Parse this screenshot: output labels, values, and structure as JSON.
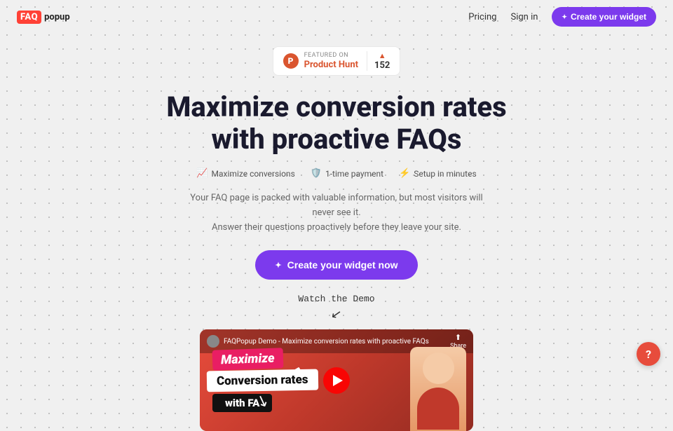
{
  "brand": {
    "logo_faq": "FAQ",
    "logo_popup": "popup"
  },
  "nav": {
    "pricing_label": "Pricing",
    "signin_label": "Sign in",
    "cta_label": "Create your widget"
  },
  "product_hunt": {
    "featured_label": "FEATURED ON",
    "name": "Product Hunt",
    "score": "152",
    "arrow": "▲"
  },
  "hero": {
    "headline_line1": "Maximize conversion rates",
    "headline_line2": "with proactive FAQs",
    "pill1_icon": "📈",
    "pill1_label": "Maximize conversions",
    "pill2_icon": "🛡️",
    "pill2_label": "1-time payment",
    "pill3_icon": "⚡",
    "pill3_label": "Setup in minutes",
    "subtext_line1": "Your FAQ page is packed with valuable information, but most visitors will never see it.",
    "subtext_line2": "Answer their questions proactively before they leave your site.",
    "cta_label": "Create your widget now"
  },
  "demo": {
    "watch_text": "Watch the Demo",
    "video_title": "FAQPopup Demo - Maximize conversion rates with proactive FAQs",
    "share_label": "Share",
    "text_maximize": "Maximize",
    "text_conversion": "Conversion rates",
    "text_faq": "with FA"
  },
  "help": {
    "label": "?"
  }
}
